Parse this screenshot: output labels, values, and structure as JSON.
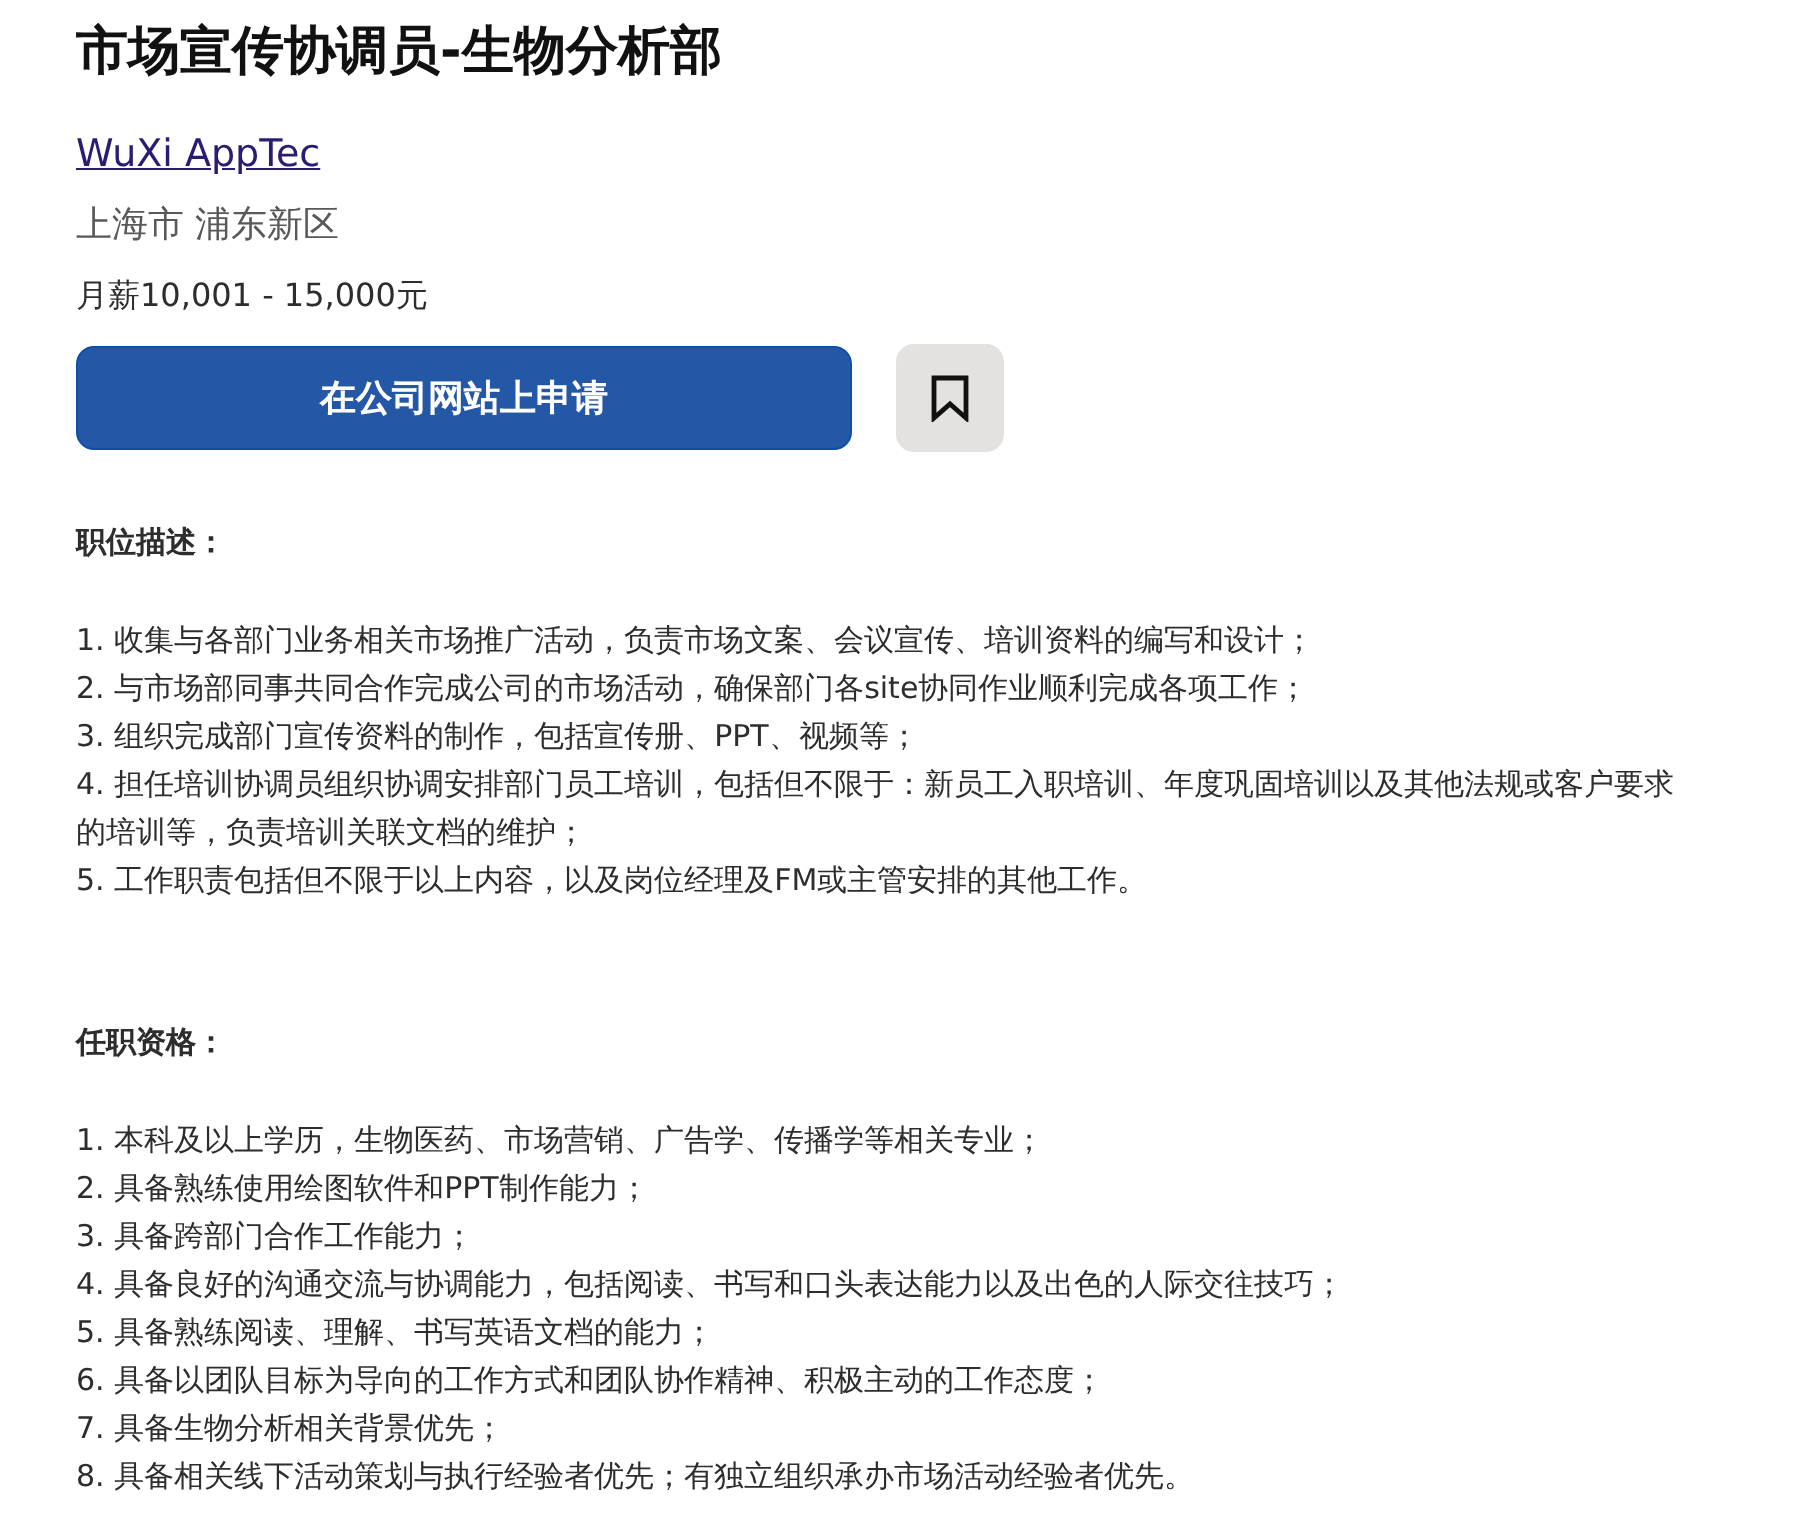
{
  "job": {
    "title": "市场宣传协调员-生物分析部",
    "company": "WuXi AppTec",
    "location": "上海市 浦东新区",
    "salary": "月薪10,001 - 15,000元"
  },
  "actions": {
    "apply_button": "在公司网站上申请",
    "bookmark": {
      "saved": false
    }
  },
  "sections": [
    {
      "heading": "职位描述：",
      "items": [
        "1. 收集与各部门业务相关市场推广活动，负责市场文案、会议宣传、培训资料的编写和设计；",
        "2. 与市场部同事共同合作完成公司的市场活动，确保部门各site协同作业顺利完成各项工作；",
        "3. 组织完成部门宣传资料的制作，包括宣传册、PPT、视频等；",
        "4. 担任培训协调员组织协调安排部门员工培训，包括但不限于：新员工入职培训、年度巩固培训以及其他法规或客户要求的培训等，负责培训关联文档的维护；",
        "5. 工作职责包括但不限于以上内容，以及岗位经理及FM或主管安排的其他工作。"
      ]
    },
    {
      "heading": "任职资格：",
      "items": [
        "1. 本科及以上学历，生物医药、市场营销、广告学、传播学等相关专业；",
        "2. 具备熟练使用绘图软件和PPT制作能力；",
        "3. 具备跨部门合作工作能力；",
        "4. 具备良好的沟通交流与协调能力，包括阅读、书写和口头表达能力以及出色的人际交往技巧；",
        "5. 具备熟练阅读、理解、书写英语文档的能力；",
        "6. 具备以团队目标为导向的工作方式和团队协作精神、积极主动的工作态度；",
        "7. 具备生物分析相关背景优先；",
        "8. 具备相关线下活动策划与执行经验者优先；有独立组织承办市场活动经验者优先。"
      ]
    }
  ]
}
